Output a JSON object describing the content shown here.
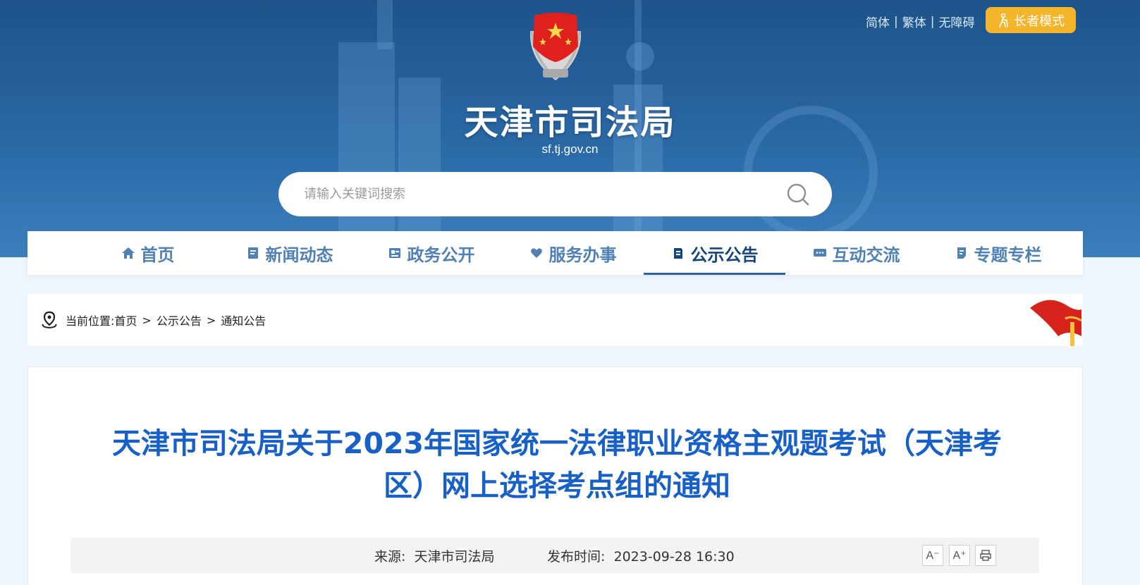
{
  "header": {
    "lang_simplified": "简体",
    "lang_traditional": "繁体",
    "accessibility": "无障碍",
    "separator": "|",
    "elder_mode": "长者模式",
    "site_title": "天津市司法局",
    "site_url": "sf.tj.gov.cn"
  },
  "search": {
    "placeholder": "请输入关键词搜索"
  },
  "nav": {
    "items": [
      {
        "label": "首页",
        "icon": "home-icon"
      },
      {
        "label": "新闻动态",
        "icon": "news-icon"
      },
      {
        "label": "政务公开",
        "icon": "government-icon"
      },
      {
        "label": "服务办事",
        "icon": "service-icon"
      },
      {
        "label": "公示公告",
        "icon": "notice-icon",
        "active": true
      },
      {
        "label": "互动交流",
        "icon": "chat-icon"
      },
      {
        "label": "专题专栏",
        "icon": "topic-icon"
      }
    ]
  },
  "breadcrumb": {
    "prefix": "当前位置:",
    "home": "首页",
    "sep": ">",
    "level1": "公示公告",
    "level2": "通知公告"
  },
  "article": {
    "title_line1": "天津市司法局关于2023年国家统一法律职业资格主观题考试（天津考",
    "title_line2": "区）网上选择考点组的通知",
    "source_label": "来源:",
    "source": "天津市司法局",
    "time_label": "发布时间:",
    "time": "2023-09-28 16:30",
    "font_smaller": "A⁻",
    "font_larger": "A⁺"
  },
  "colors": {
    "banner": "#1d5389",
    "nav_text": "#4f80b6",
    "title_blue": "#1760c8",
    "elder_btn": "#f4b52a"
  }
}
